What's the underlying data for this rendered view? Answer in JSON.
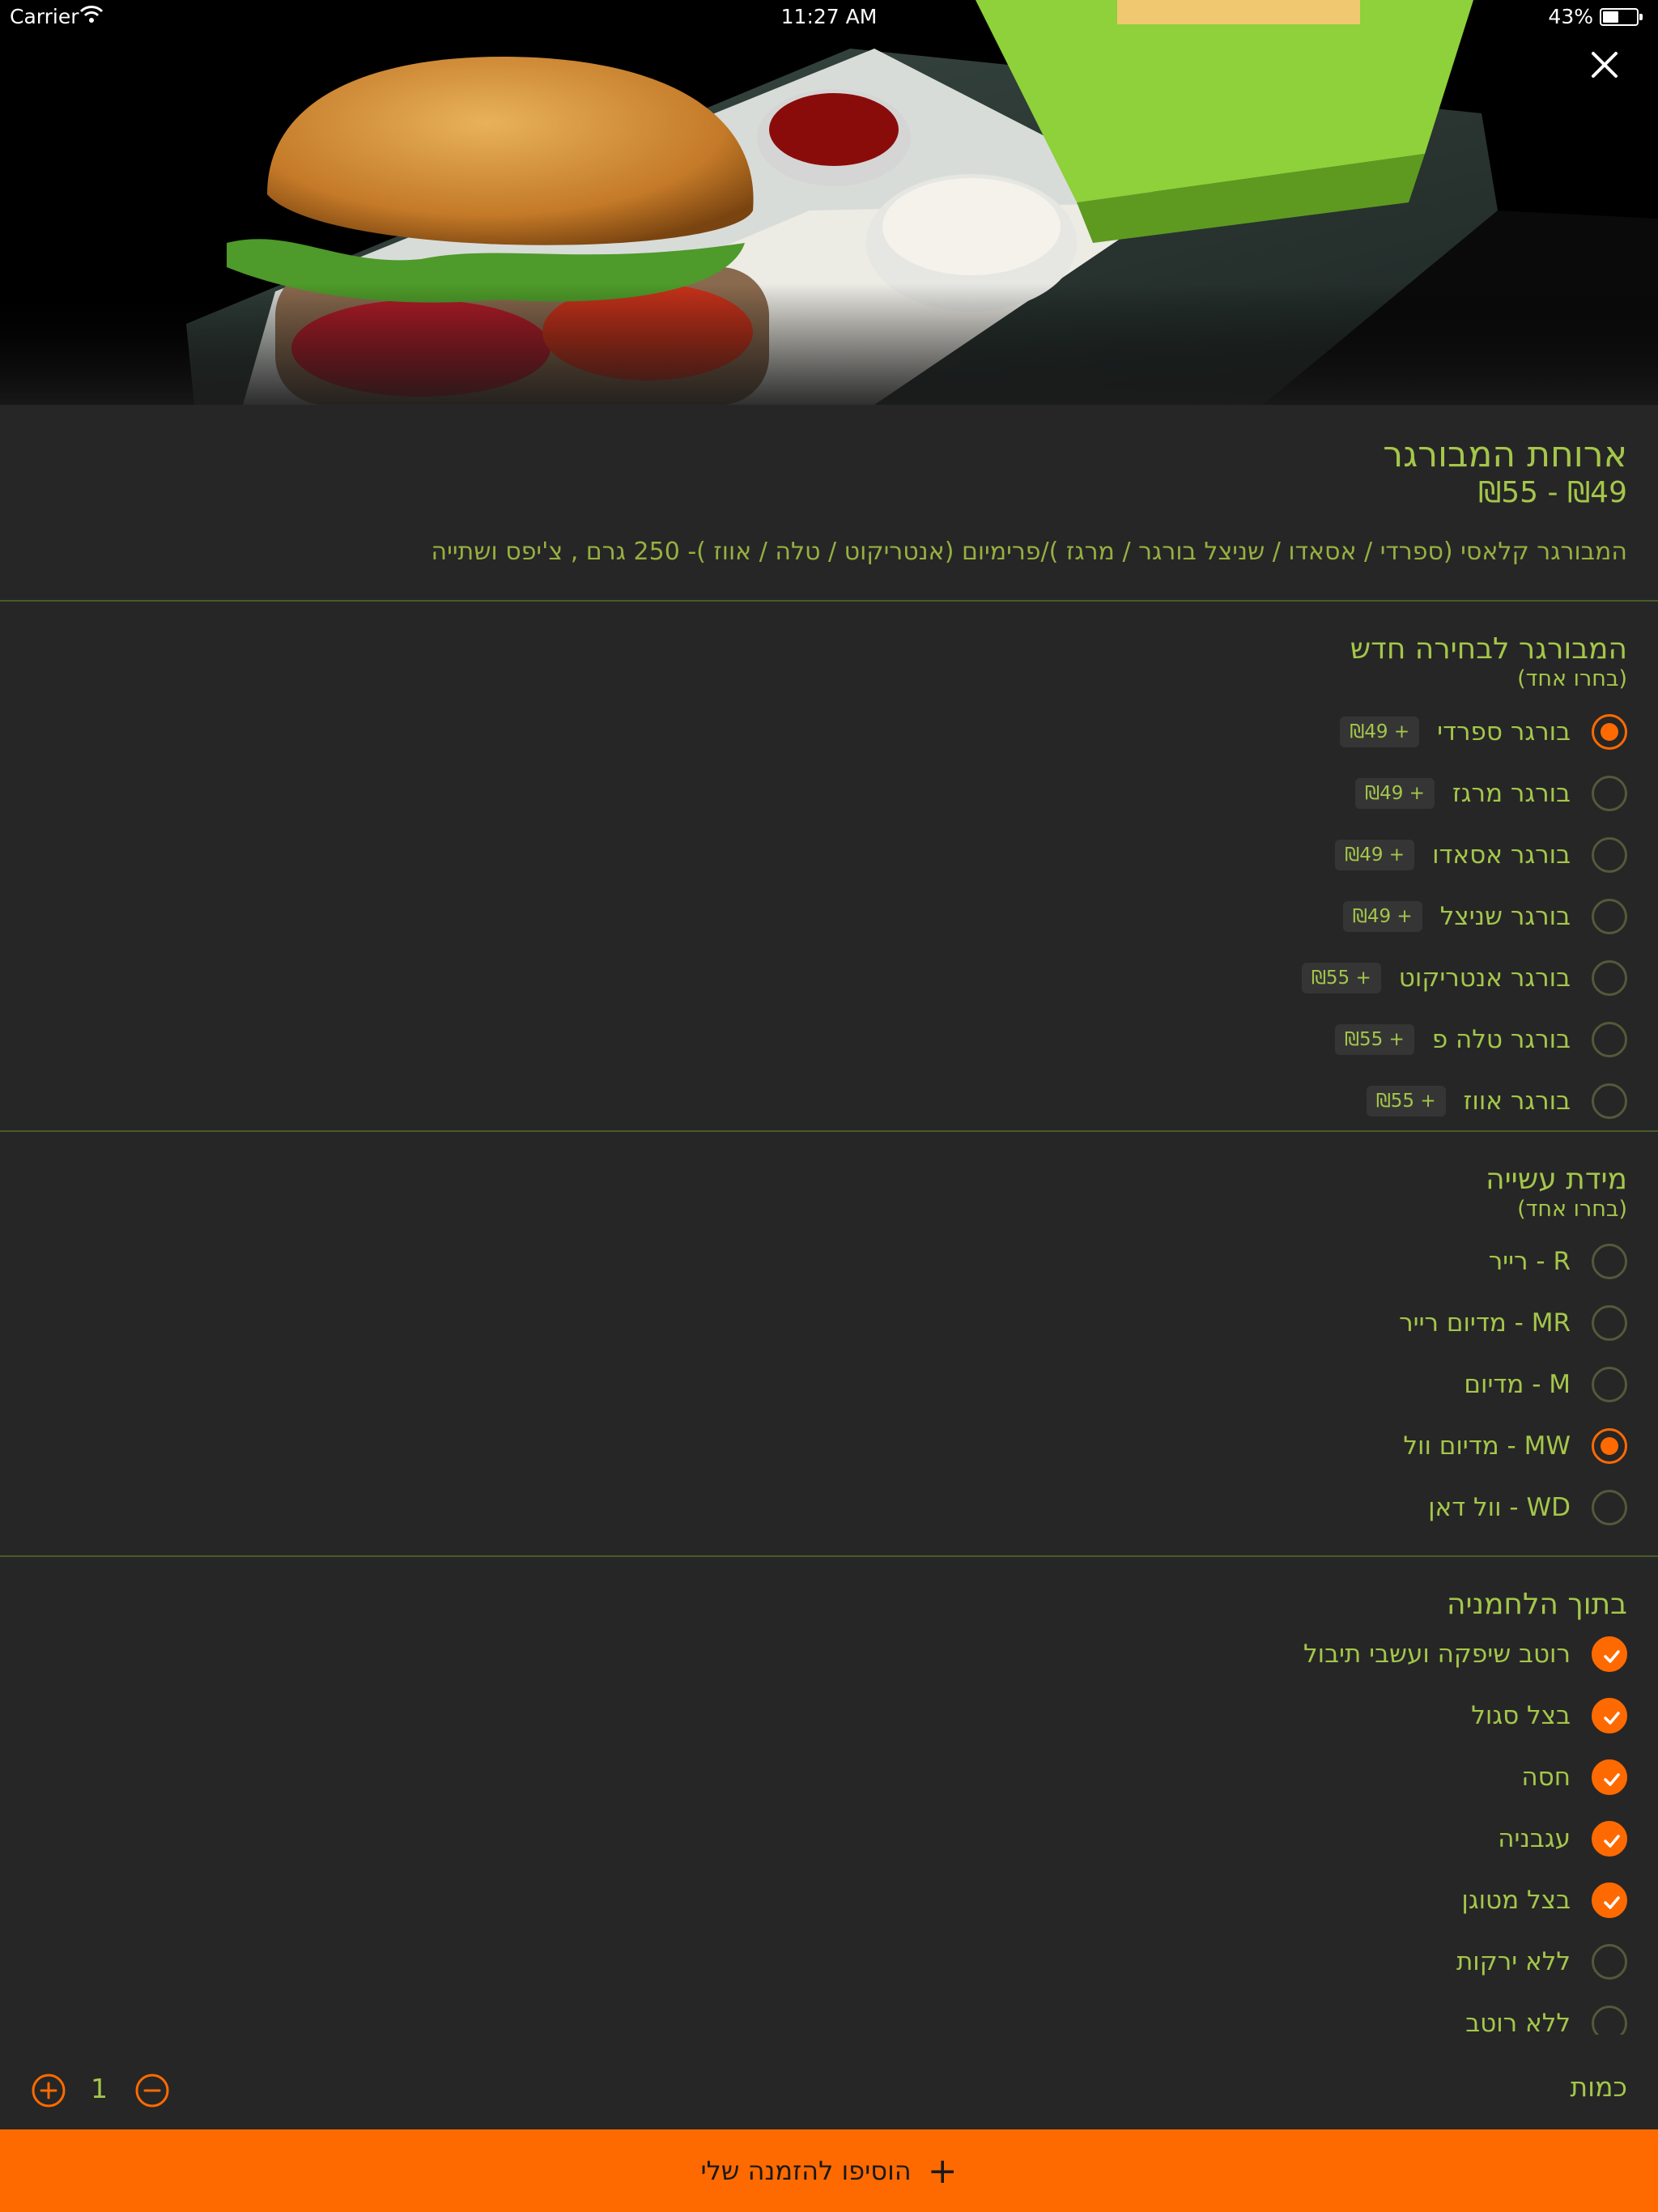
{
  "status_bar": {
    "carrier": "Carrier",
    "time": "11:27 AM",
    "battery": "43%"
  },
  "product": {
    "title": "ארוחת המבורגר",
    "price": "₪49 - ₪55",
    "description": "המבורגר קלאסי (ספרדי / אסאדו / שניצל בורגר / מרגז )/פרימיום (אנטריקוט / טלה / אווז )- 250 גרם , צ'יפס ושתייה"
  },
  "burger_section": {
    "title": "המבורגר לבחירה חדש",
    "subtitle": "(בחרו אחד)",
    "options": [
      {
        "label": "בורגר ספרדי",
        "price": "+ ₪49",
        "selected": true
      },
      {
        "label": "בורגר מרגז",
        "price": "+ ₪49",
        "selected": false
      },
      {
        "label": "בורגר אסאדו",
        "price": "+ ₪49",
        "selected": false
      },
      {
        "label": "בורגר שניצל",
        "price": "+ ₪49",
        "selected": false
      },
      {
        "label": "בורגר אנטריקוט",
        "price": "+ ₪55",
        "selected": false
      },
      {
        "label": "בורגר טלה פ",
        "price": "+ ₪55",
        "selected": false
      },
      {
        "label": "בורגר אווז",
        "price": "+ ₪55",
        "selected": false
      }
    ]
  },
  "doneness_section": {
    "title": "מידת עשייה",
    "subtitle": "(בחרו אחד)",
    "options": [
      {
        "label": "R - רייר",
        "selected": false
      },
      {
        "label": "MR - מדיום רייר",
        "selected": false
      },
      {
        "label": "M - מדיום",
        "selected": false
      },
      {
        "label": "MW - מדיום וול",
        "selected": true
      },
      {
        "label": "WD - וול דאן",
        "selected": false
      }
    ]
  },
  "bun_section": {
    "title": "בתוך הלחמניה",
    "options": [
      {
        "label": "רוטב שיפקה ועשבי תיבול",
        "checked": true
      },
      {
        "label": "בצל סגול",
        "checked": true
      },
      {
        "label": "חסה",
        "checked": true
      },
      {
        "label": "עגבניה",
        "checked": true
      },
      {
        "label": "בצל מטוגן",
        "checked": true
      },
      {
        "label": "ללא ירקות",
        "checked": false
      },
      {
        "label": "ללא רוטב",
        "checked": false
      }
    ]
  },
  "quantity": {
    "label": "כמות",
    "value": "1"
  },
  "add_button": {
    "label": "הוסיפו להזמנה שלי"
  },
  "colors": {
    "accent": "#ff6a00",
    "text": "#a4c64a",
    "background": "#262626"
  },
  "icons": [
    "wifi-icon",
    "battery-icon",
    "close-icon",
    "radio-icon",
    "checkbox-check-icon",
    "plus-circle-icon",
    "minus-circle-icon",
    "plus-icon"
  ]
}
